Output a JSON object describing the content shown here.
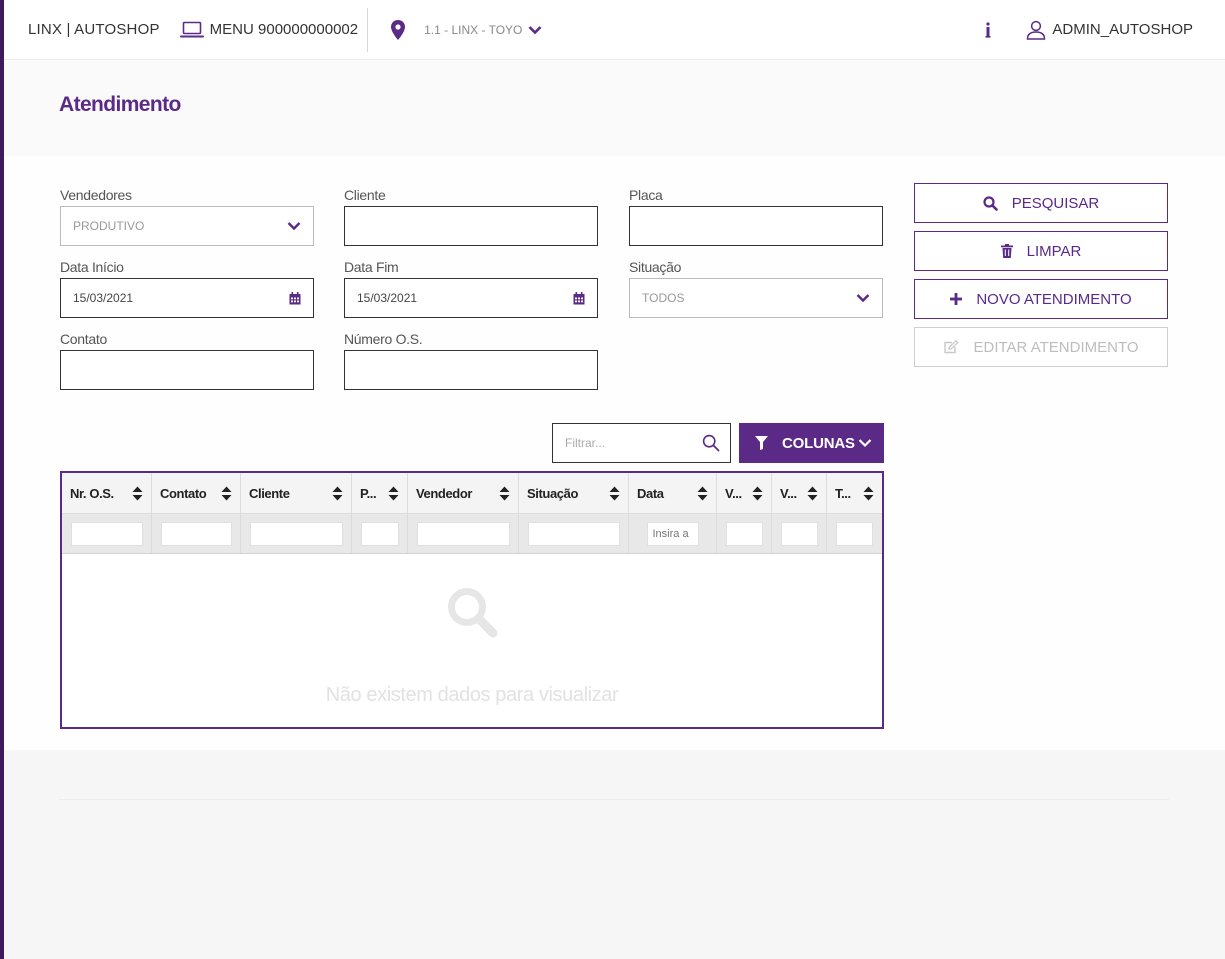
{
  "header": {
    "brand": "LINX | AUTOSHOP",
    "menu_label": "MENU 900000000002",
    "branch": "1.1 - LINX - TOYO",
    "user": "ADMIN_AUTOSHOP"
  },
  "page": {
    "title": "Atendimento"
  },
  "form": {
    "vendedores": {
      "label": "Vendedores",
      "value": "PRODUTIVO"
    },
    "cliente": {
      "label": "Cliente",
      "value": ""
    },
    "placa": {
      "label": "Placa",
      "value": ""
    },
    "data_inicio": {
      "label": "Data Início",
      "value": "15/03/2021"
    },
    "data_fim": {
      "label": "Data Fim",
      "value": "15/03/2021"
    },
    "situacao": {
      "label": "Situação",
      "value": "TODOS"
    },
    "contato": {
      "label": "Contato",
      "value": ""
    },
    "numero_os": {
      "label": "Número O.S.",
      "value": ""
    }
  },
  "actions": {
    "pesquisar": "PESQUISAR",
    "limpar": "LIMPAR",
    "novo": "NOVO ATENDIMENTO",
    "editar": "EDITAR ATENDIMENTO"
  },
  "grid": {
    "filter_placeholder": "Filtrar...",
    "columns_button": "COLUNAS",
    "columns": [
      "Nr. O.S.",
      "Contato",
      "Cliente",
      "P...",
      "Vendedor",
      "Situação",
      "Data",
      "V...",
      "V...",
      "T..."
    ],
    "date_filter_placeholder": "Insira a",
    "empty_message": "Não existem dados para visualizar"
  },
  "colors": {
    "accent": "#5b2a86",
    "sidebar": "#3d1a5e"
  }
}
